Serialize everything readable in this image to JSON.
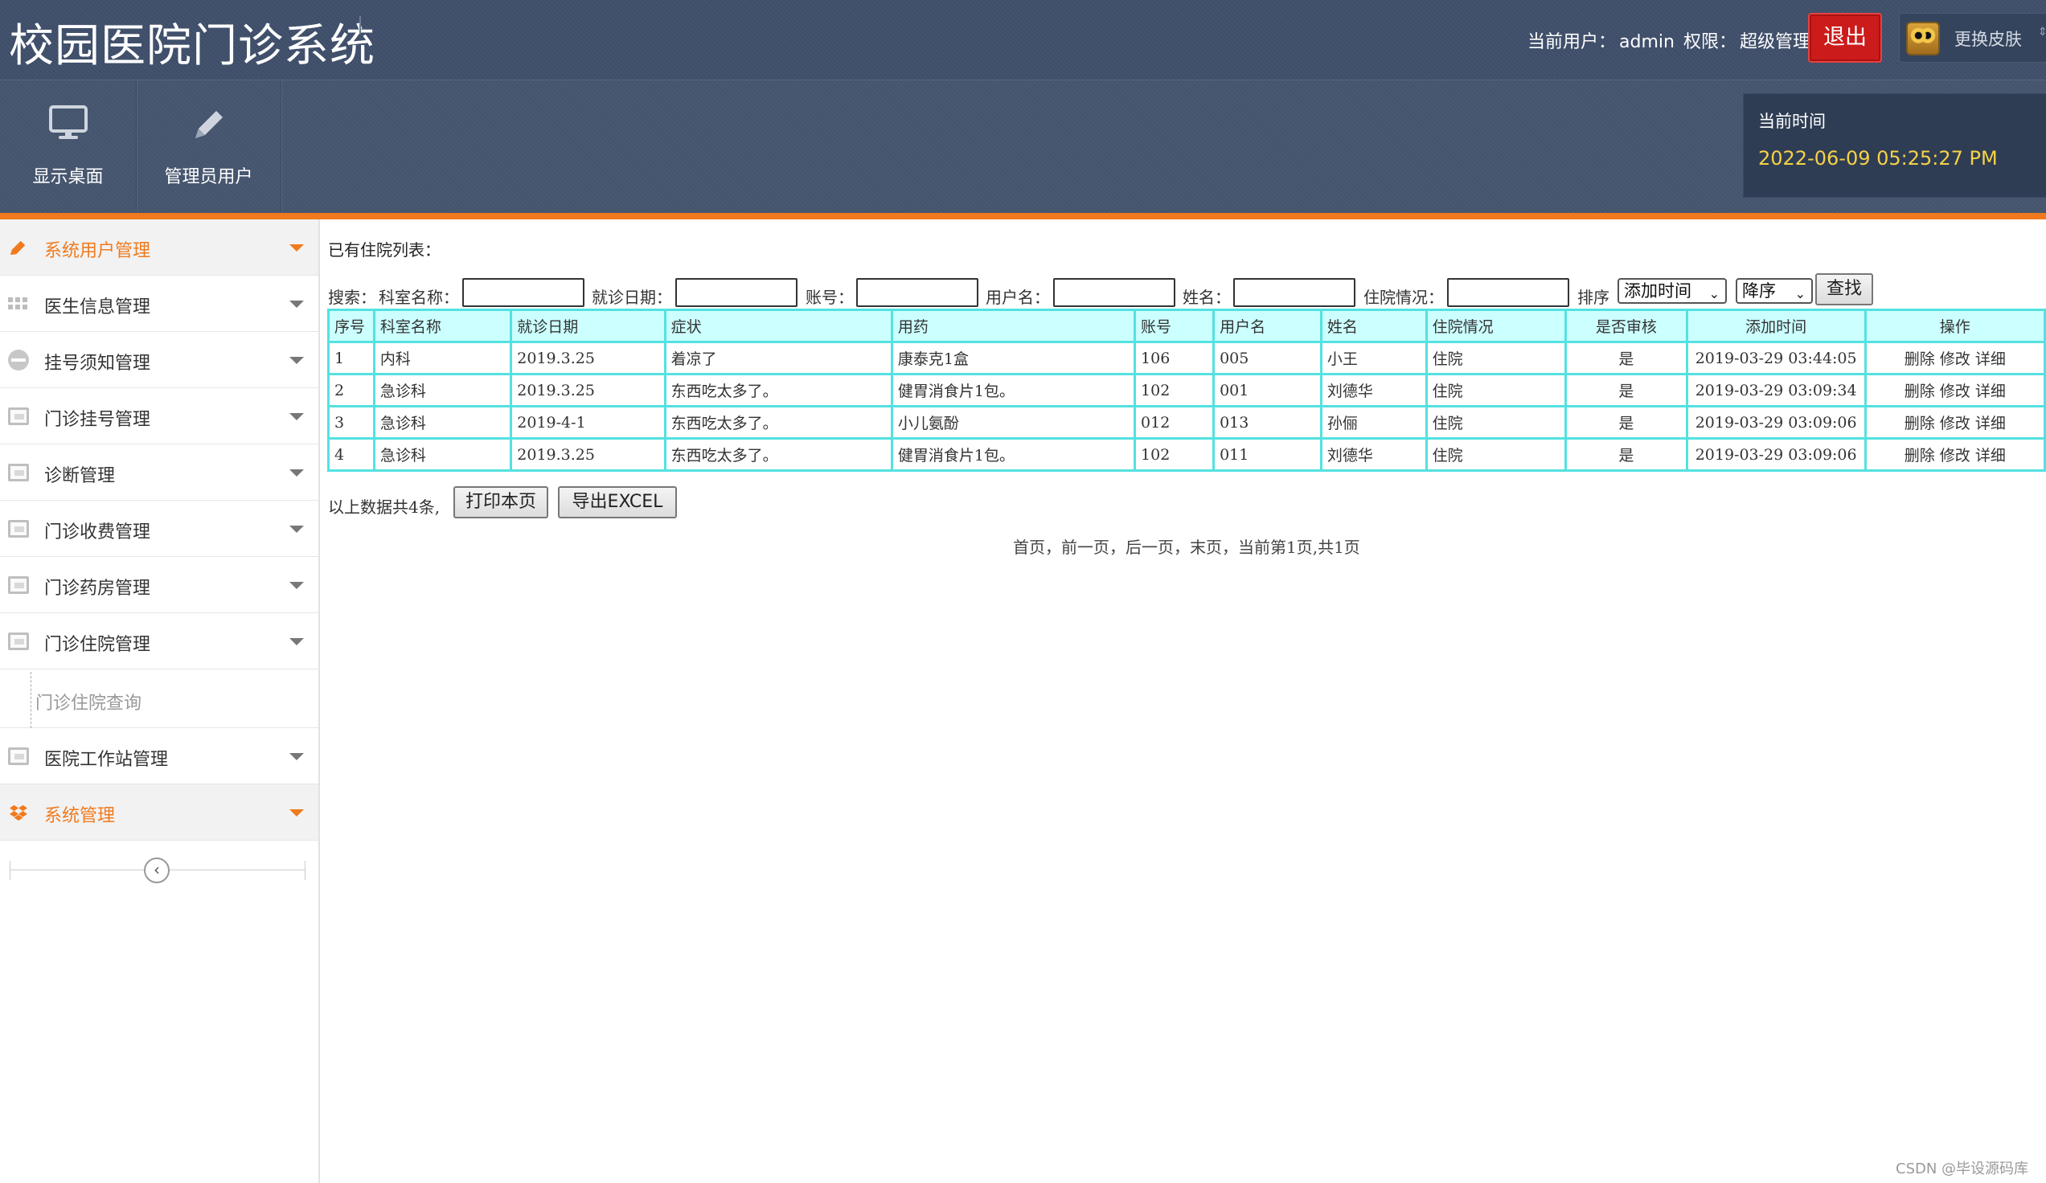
{
  "header": {
    "app_title": "校园医院门诊系统",
    "current_user_label": "当前用户：",
    "current_user": "admin",
    "role_label": "权限：",
    "role": "超级管理员",
    "logout_label": "退出",
    "skin_label": "更换皮肤",
    "skin_arrow": "⇕"
  },
  "toolbar": {
    "items": [
      {
        "label": "显示桌面",
        "icon": "monitor-icon"
      },
      {
        "label": "管理员用户",
        "icon": "pencil-icon"
      }
    ],
    "time_label": "当前时间",
    "time_value": "2022-06-09 05:25:27 PM"
  },
  "sidebar": {
    "items": [
      {
        "label": "系统用户管理",
        "icon": "pencil-icon"
      },
      {
        "label": "医生信息管理",
        "icon": "grid-icon"
      },
      {
        "label": "挂号须知管理",
        "icon": "minus-circle-icon"
      },
      {
        "label": "门诊挂号管理",
        "icon": "screen-icon"
      },
      {
        "label": "诊断管理",
        "icon": "screen-icon"
      },
      {
        "label": "门诊收费管理",
        "icon": "screen-icon"
      },
      {
        "label": "门诊药房管理",
        "icon": "screen-icon"
      },
      {
        "label": "门诊住院管理",
        "icon": "screen-icon"
      },
      {
        "label": "医院工作站管理",
        "icon": "screen-icon"
      },
      {
        "label": "系统管理",
        "icon": "dropbox-icon"
      }
    ],
    "submenu_label": "门诊住院查询",
    "collapse_glyph": "‹"
  },
  "main": {
    "list_title": "已有住院列表：",
    "search": {
      "prefix": "搜索：",
      "dept_label": "科室名称：",
      "date_label": "就诊日期：",
      "account_label": "账号：",
      "username_label": "用户名：",
      "name_label": "姓名：",
      "status_label": "住院情况：",
      "sort_label": "排序",
      "sort_field": "添加时间",
      "sort_order": "降序",
      "search_button": "查找",
      "caret": "⌄"
    },
    "table": {
      "headers": [
        "序号",
        "科室名称",
        "就诊日期",
        "症状",
        "用药",
        "账号",
        "用户名",
        "姓名",
        "住院情况",
        "是否审核",
        "添加时间",
        "操作"
      ],
      "rows": [
        [
          "1",
          "内科",
          "2019.3.25",
          "着凉了",
          "康泰克1盒",
          "106",
          "005",
          "小王",
          "住院",
          "是",
          "2019-03-29 03:44:05"
        ],
        [
          "2",
          "急诊科",
          "2019.3.25",
          "东西吃太多了。",
          "健胃消食片1包。",
          "102",
          "001",
          "刘德华",
          "住院",
          "是",
          "2019-03-29 03:09:34"
        ],
        [
          "3",
          "急诊科",
          "2019-4-1",
          "东西吃太多了。",
          "小儿氨酚",
          "012",
          "013",
          "孙俪",
          "住院",
          "是",
          "2019-03-29 03:09:06"
        ],
        [
          "4",
          "急诊科",
          "2019.3.25",
          "东西吃太多了。",
          "健胃消食片1包。",
          "102",
          "011",
          "刘德华",
          "住院",
          "是",
          "2019-03-29 03:09:06"
        ]
      ],
      "actions": [
        "删除",
        "修改",
        "详细"
      ]
    },
    "total_text": "以上数据共4条,",
    "print_button": "打印本页",
    "export_button": "导出EXCEL",
    "pager": "首页，前一页，后一页，末页，当前第1页,共1页"
  },
  "watermark": "CSDN @毕设源码库",
  "colors": {
    "header_bg": "#3f4f6b",
    "accent_orange": "#f07a1d",
    "logout_red": "#cc1b1b",
    "time_yellow": "#f5d247",
    "table_border": "#54e1e1",
    "table_header_bg": "#ccffff"
  }
}
